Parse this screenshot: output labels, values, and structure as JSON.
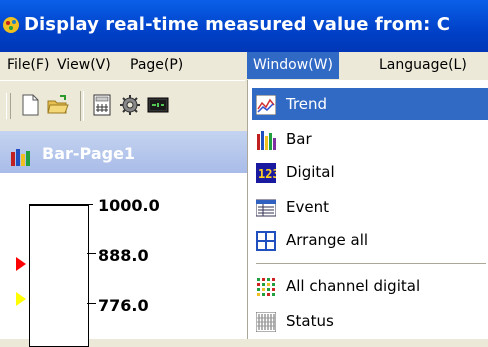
{
  "window": {
    "title": "Display real-time measured value from: C"
  },
  "menubar": {
    "items": [
      {
        "label": "File(F)"
      },
      {
        "label": "View(V)"
      },
      {
        "label": "Page(P)"
      },
      {
        "label": "Window(W)",
        "open": true
      },
      {
        "label": "Language(L)"
      }
    ]
  },
  "toolbar": {
    "buttons": [
      "new-document-icon",
      "open-folder-icon",
      "calculator-icon",
      "settings-gear-icon",
      "display-icon"
    ]
  },
  "page": {
    "title": "Bar-Page1",
    "scale_labels": [
      "1000.0",
      "888.0",
      "776.0"
    ],
    "markers": [
      {
        "color": "#ff0000"
      },
      {
        "color": "#ffff00"
      }
    ]
  },
  "window_menu": {
    "items": [
      {
        "label": "Trend",
        "icon": "trend-icon",
        "highlighted": true
      },
      {
        "label": "Bar",
        "icon": "bar-icon"
      },
      {
        "label": "Digital",
        "icon": "digital-icon"
      },
      {
        "label": "Event",
        "icon": "event-icon"
      },
      {
        "label": "Arrange all",
        "icon": "arrange-all-icon"
      },
      {
        "label": "All channel digital",
        "icon": "all-channel-digital-icon"
      },
      {
        "label": "Status",
        "icon": "status-icon"
      }
    ]
  },
  "colors": {
    "title_bar": "#0a5fe8",
    "menu_highlight": "#316ac5",
    "page_header": "#a9bce8"
  }
}
